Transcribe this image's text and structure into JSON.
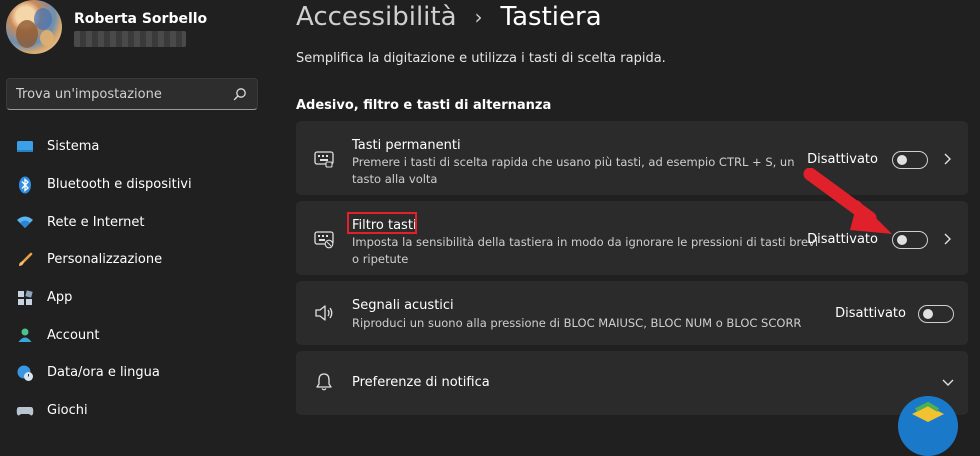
{
  "user": {
    "name": "Roberta Sorbello"
  },
  "search": {
    "placeholder": "Trova un'impostazione"
  },
  "sidebar": {
    "items": [
      {
        "label": "Sistema",
        "icon": "monitor-icon"
      },
      {
        "label": "Bluetooth e dispositivi",
        "icon": "bluetooth-icon"
      },
      {
        "label": "Rete e Internet",
        "icon": "wifi-icon"
      },
      {
        "label": "Personalizzazione",
        "icon": "paintbrush-icon"
      },
      {
        "label": "App",
        "icon": "apps-icon"
      },
      {
        "label": "Account",
        "icon": "person-icon"
      },
      {
        "label": "Data/ora e lingua",
        "icon": "globe-clock-icon"
      },
      {
        "label": "Giochi",
        "icon": "controller-icon"
      }
    ]
  },
  "header": {
    "parent": "Accessibilità",
    "separator": "›",
    "current": "Tastiera",
    "subtitle": "Semplifica la digitazione e utilizza i tasti di scelta rapida."
  },
  "section": {
    "title": "Adesivo, filtro e tasti di alternanza"
  },
  "settings": [
    {
      "title": "Tasti permanenti",
      "desc_line1": "Premere i tasti di scelta rapida che usano più tasti, ad esempio CTRL + S, un",
      "desc_line2": "tasto alla volta",
      "state": "Disattivato",
      "icon": "keyboard-icon"
    },
    {
      "title": "Filtro tasti",
      "desc_line1": "Imposta la sensibilità della tastiera in modo da ignorare le pressioni di tasti brevi",
      "desc_line2": "o ripetute",
      "state": "Disattivato",
      "icon": "keyboard-filter-icon"
    },
    {
      "title": "Segnali acustici",
      "desc_line1": "Riproduci un suono alla pressione di BLOC MAIUSC, BLOC NUM o BLOC SCORR",
      "state": "Disattivato",
      "icon": "speaker-icon"
    },
    {
      "title": "Preferenze di notifica",
      "icon": "bell-icon"
    }
  ],
  "colors": {
    "background": "#202020",
    "card": "#2b2b2b",
    "annotation_red": "#e0212b"
  }
}
